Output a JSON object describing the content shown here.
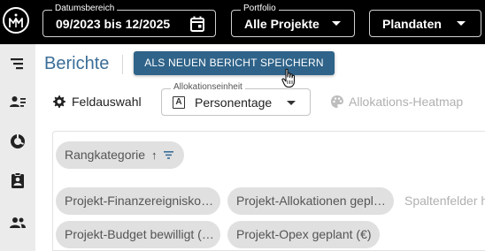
{
  "header": {
    "date_range": {
      "label": "Datumsbereich",
      "value": "09/2023 bis 12/2025"
    },
    "portfolio": {
      "label": "Portfolio",
      "value": "Alle Projekte"
    },
    "data_mode": {
      "value": "Plandaten"
    }
  },
  "sidebar": {
    "items": [
      {
        "icon": "list-filter-icon"
      },
      {
        "icon": "user-list-icon"
      },
      {
        "icon": "donut-chart-icon"
      },
      {
        "icon": "clipboard-user-icon"
      },
      {
        "icon": "people-icon"
      }
    ]
  },
  "main": {
    "title": "Berichte",
    "save_button": "ALS NEUEN BERICHT SPEICHERN",
    "field_selection": "Feldauswahl",
    "allocation_unit": {
      "label": "Allokationseinheit",
      "value": "Personentage",
      "badge": "A"
    },
    "heatmap": "Allokations-Heatmap",
    "rank_chip": "Rangkategorie",
    "column_chips": [
      "Projekt-Finanzereignisko…",
      "Projekt-Allokationen gepl…",
      "Projekt-Budget bewilligt (…",
      "Projekt-Opex geplant (€)"
    ],
    "column_hint": "Spaltenfelder h"
  },
  "colors": {
    "topbar": "#000000",
    "accent": "#3b6e98",
    "button": "#2f6389",
    "sidebar": "#ebebeb",
    "chip": "#e0e0e0"
  }
}
